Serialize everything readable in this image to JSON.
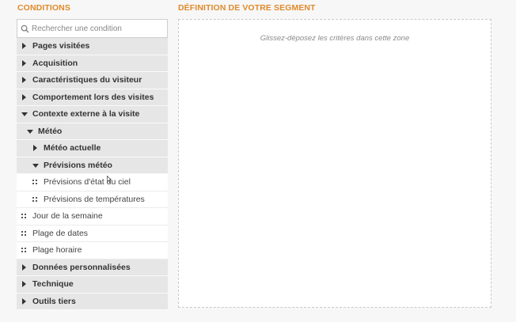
{
  "conditions": {
    "title": "CONDITIONS",
    "search_placeholder": "Rechercher une condition",
    "items": [
      {
        "label": "Pages visitées",
        "type": "group",
        "level": 0,
        "expanded": false
      },
      {
        "label": "Acquisition",
        "type": "group",
        "level": 0,
        "expanded": false
      },
      {
        "label": "Caractéristiques du visiteur",
        "type": "group",
        "level": 0,
        "expanded": false
      },
      {
        "label": "Comportement lors des visites",
        "type": "group",
        "level": 0,
        "expanded": false
      },
      {
        "label": "Contexte externe à la visite",
        "type": "group",
        "level": 0,
        "expanded": true
      },
      {
        "label": "Météo",
        "type": "group",
        "level": 1,
        "expanded": true
      },
      {
        "label": "Météo actuelle",
        "type": "group",
        "level": 2,
        "expanded": false
      },
      {
        "label": "Prévisions météo",
        "type": "group",
        "level": 2,
        "expanded": true
      },
      {
        "label": "Prévisions d'état du ciel",
        "type": "leaf",
        "level": 2
      },
      {
        "label": "Prévisions de températures",
        "type": "leaf",
        "level": 2
      },
      {
        "label": "Jour de la semaine",
        "type": "leaf",
        "level": 0
      },
      {
        "label": "Plage de dates",
        "type": "leaf",
        "level": 0
      },
      {
        "label": "Plage horaire",
        "type": "leaf",
        "level": 0
      },
      {
        "label": "Données personnalisées",
        "type": "group",
        "level": 0,
        "expanded": false
      },
      {
        "label": "Technique",
        "type": "group",
        "level": 0,
        "expanded": false
      },
      {
        "label": "Outils tiers",
        "type": "group",
        "level": 0,
        "expanded": false
      }
    ]
  },
  "segment": {
    "title": "DÉFINITION DE VOTRE SEGMENT",
    "drop_hint": "Glissez-déposez les critères dans cette zone"
  },
  "colors": {
    "accent": "#e08a2c",
    "group_bg": "#e6e6e6",
    "leaf_bg": "#ffffff"
  },
  "icons": {
    "search": "search-icon",
    "collapsed": "caret-right-icon",
    "expanded": "caret-down-icon",
    "drag": "drag-handle-icon"
  }
}
